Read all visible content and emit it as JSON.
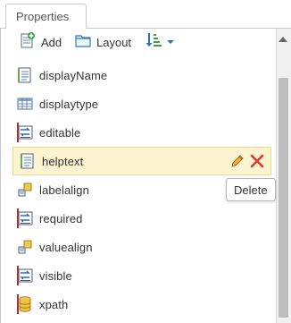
{
  "tab": {
    "label": "Properties"
  },
  "toolbar": {
    "add_label": "Add",
    "layout_label": "Layout"
  },
  "properties": [
    {
      "name": "displayName",
      "icon": "text-field-icon",
      "required": false,
      "selected": false
    },
    {
      "name": "displaytype",
      "icon": "table-grid-icon",
      "required": false,
      "selected": false
    },
    {
      "name": "editable",
      "icon": "boolean-toggle-icon",
      "required": true,
      "selected": false
    },
    {
      "name": "helptext",
      "icon": "text-field-icon",
      "required": false,
      "selected": true
    },
    {
      "name": "labelalign",
      "icon": "align-icon",
      "required": false,
      "selected": false
    },
    {
      "name": "required",
      "icon": "boolean-toggle-icon",
      "required": true,
      "selected": false
    },
    {
      "name": "valuealign",
      "icon": "align-icon",
      "required": false,
      "selected": false
    },
    {
      "name": "visible",
      "icon": "boolean-toggle-icon",
      "required": true,
      "selected": false
    },
    {
      "name": "xpath",
      "icon": "database-icon",
      "required": true,
      "selected": false
    }
  ],
  "tooltip": {
    "text": "Delete"
  },
  "colors": {
    "selected_bg": "#fcf3d0",
    "required_bar": "#c0282d",
    "delete_red": "#e03a2f"
  }
}
